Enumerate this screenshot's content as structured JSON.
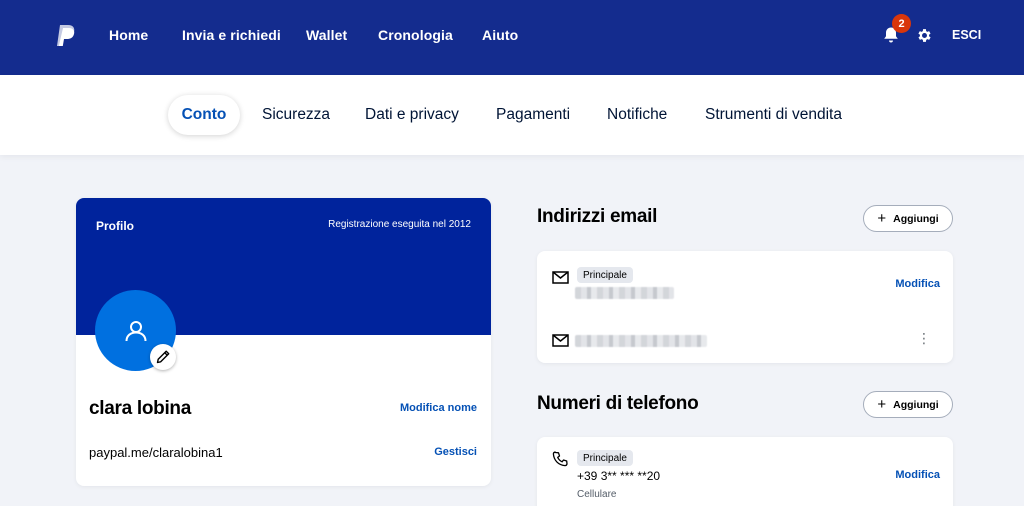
{
  "colors": {
    "nav_bg": "#142c8e",
    "banner_bg": "#00239c",
    "avatar_bg": "#0070e0",
    "link_blue": "#0551b5",
    "badge_red": "#d9360b",
    "page_bg": "#f1f3f8"
  },
  "topnav": {
    "logo_icon": "paypal-logo",
    "links": [
      "Home",
      "Invia e richiedi",
      "Wallet",
      "Cronologia",
      "Aiuto"
    ],
    "notification_count": "2",
    "logout_label": "ESCI"
  },
  "tabs": {
    "active": "Conto",
    "others": [
      "Sicurezza",
      "Dati e privacy",
      "Pagamenti",
      "Notifiche",
      "Strumenti di vendita"
    ]
  },
  "profile": {
    "header_label": "Profilo",
    "registration": "Registrazione eseguita nel 2012",
    "name": "clara lobina",
    "edit_name_label": "Modifica nome",
    "paypal_me": "paypal.me/claralobina1",
    "manage_label": "Gestisci"
  },
  "emails": {
    "title": "Indirizzi email",
    "add_label": "Aggiungi",
    "primary_chip": "Principale",
    "edit_label": "Modifica"
  },
  "phones": {
    "title": "Numeri di telefono",
    "add_label": "Aggiungi",
    "primary_chip": "Principale",
    "number": "+39 3** *** **20",
    "type": "Cellulare",
    "edit_label": "Modifica"
  }
}
